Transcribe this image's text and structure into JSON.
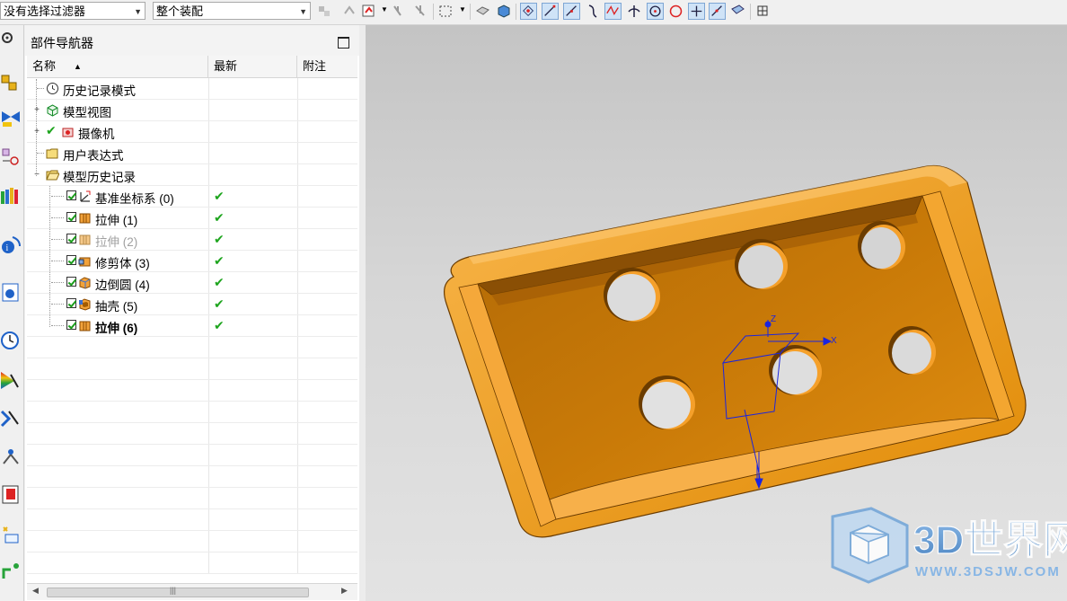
{
  "toolbar": {
    "filter_value": "没有选择过滤器",
    "scope_value": "整个装配"
  },
  "navigator": {
    "title": "部件导航器",
    "columns": {
      "name": "名称",
      "latest": "最新",
      "note": "附注"
    },
    "rows": [
      {
        "label": "历史记录模式"
      },
      {
        "label": "模型视图"
      },
      {
        "label": "摄像机"
      },
      {
        "label": "用户表达式"
      },
      {
        "label": "模型历史记录"
      },
      {
        "label": "基准坐标系 (0)",
        "latest": "✔"
      },
      {
        "label": "拉伸 (1)",
        "latest": "✔"
      },
      {
        "label": "拉伸 (2)",
        "latest": "✔"
      },
      {
        "label": "修剪体 (3)",
        "latest": "✔"
      },
      {
        "label": "边倒圆 (4)",
        "latest": "✔"
      },
      {
        "label": "抽壳 (5)",
        "latest": "✔"
      },
      {
        "label": "拉伸 (6)",
        "latest": "✔"
      }
    ]
  },
  "viewport": {
    "axis_x": "X",
    "axis_y": "Y",
    "axis_z": "Z",
    "part_color": "#f29a0c",
    "watermark_title": "3D世界网",
    "watermark_url": "WWW.3DSJW.COM"
  },
  "colors": {
    "accent": "#2f6fb3",
    "check": "#1ea51e"
  }
}
